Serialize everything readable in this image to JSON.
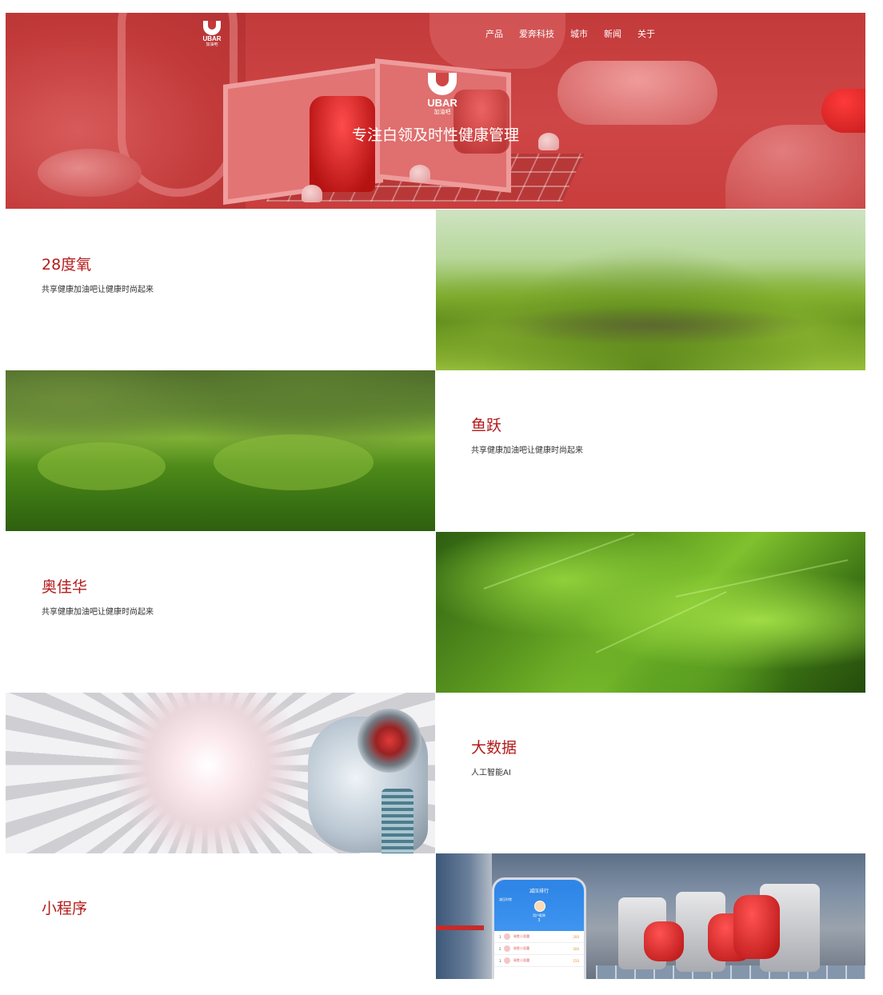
{
  "header": {
    "logo_small": {
      "mark": "U",
      "text": "UBAR",
      "sub": "加油吧"
    },
    "nav": [
      {
        "label": "产品"
      },
      {
        "label": "爱奔科技"
      },
      {
        "label": "城市"
      },
      {
        "label": "新闻"
      },
      {
        "label": "关于"
      }
    ],
    "logo_big": {
      "mark": "U",
      "text": "UBAR",
      "sub": "加油吧"
    },
    "tagline": "专注白领及时性健康管理"
  },
  "sections": [
    {
      "title": "28度氧",
      "desc": "共享健康加油吧让健康时尚起来",
      "image": "moss-photo",
      "text_side": "left"
    },
    {
      "title": "鱼跃",
      "desc": "共享健康加油吧让健康时尚起来",
      "image": "grass-photo",
      "text_side": "right"
    },
    {
      "title": "奥佳华",
      "desc": "共享健康加油吧让健康时尚起来",
      "image": "leaf-photo",
      "text_side": "left"
    },
    {
      "title": "大数据",
      "desc": "人工智能AI",
      "image": "robot-photo",
      "text_side": "right"
    },
    {
      "title": "小程序",
      "desc": "",
      "image": "app-showroom-photo",
      "text_side": "left"
    }
  ],
  "phone_mock": {
    "title": "减压排行",
    "label": "减压时常",
    "user": "用户昵称",
    "rank": "3",
    "rows": [
      {
        "num": "1",
        "name": "致胜小恶魔",
        "points": "200"
      },
      {
        "num": "2",
        "name": "致胜小恶魔",
        "points": "200"
      },
      {
        "num": "3",
        "name": "致胜小恶魔",
        "points": "150"
      }
    ]
  },
  "colors": {
    "brand_red": "#b31b1b",
    "hero_red": "#c23a3a",
    "text": "#333333"
  }
}
